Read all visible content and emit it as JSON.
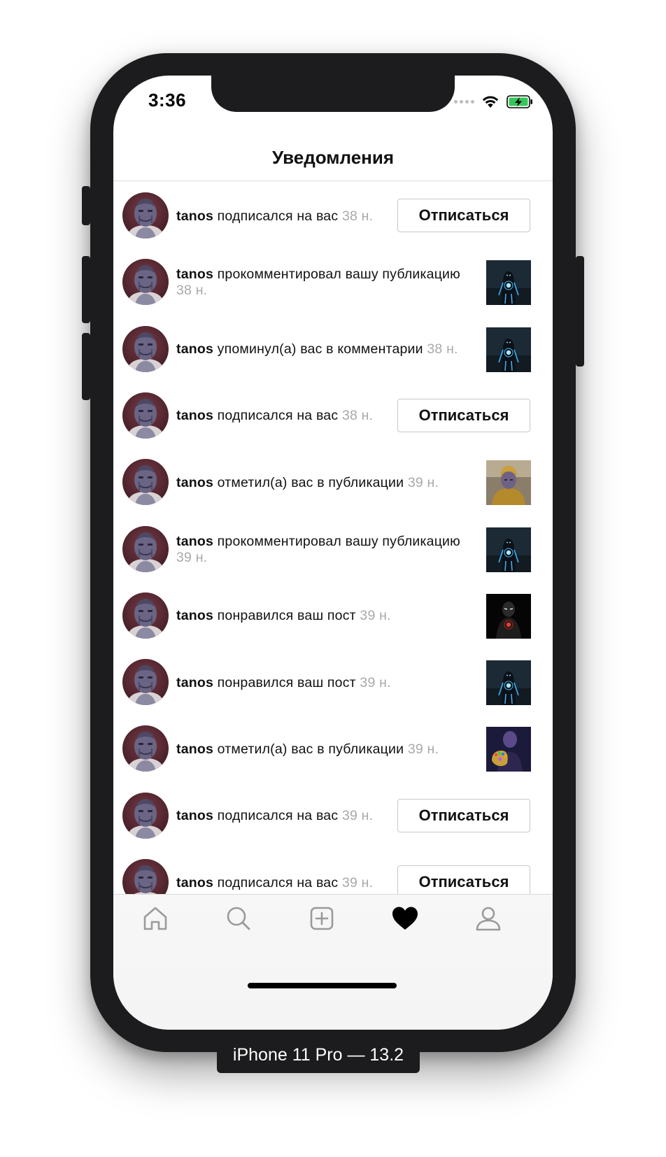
{
  "status_bar": {
    "time": "3:36"
  },
  "header": {
    "title": "Уведомления"
  },
  "notifications": [
    {
      "user": "tanos",
      "action": "подписался на вас",
      "time": "38 н.",
      "type": "follow",
      "button_label": "Отписаться"
    },
    {
      "user": "tanos",
      "action": "прокомментировал вашу публикацию",
      "time": "38 н.",
      "type": "comment",
      "thumb": "ironman-blue"
    },
    {
      "user": "tanos",
      "action": "упоминул(а) вас в комментарии",
      "time": "38 н.",
      "type": "mention",
      "thumb": "ironman-blue"
    },
    {
      "user": "tanos",
      "action": "подписался на вас",
      "time": "38 н.",
      "type": "follow",
      "button_label": "Отписаться"
    },
    {
      "user": "tanos",
      "action": "отметил(а) вас в публикации",
      "time": "39 н.",
      "type": "tag",
      "thumb": "thanos-gold"
    },
    {
      "user": "tanos",
      "action": "прокомментировал вашу публикацию",
      "time": "39 н.",
      "type": "comment",
      "thumb": "ironman-blue"
    },
    {
      "user": "tanos",
      "action": "понравился ваш пост",
      "time": "39 н.",
      "type": "like",
      "thumb": "ironman-red"
    },
    {
      "user": "tanos",
      "action": "понравился ваш пост",
      "time": "39 н.",
      "type": "like",
      "thumb": "ironman-blue"
    },
    {
      "user": "tanos",
      "action": "отметил(а) вас в публикации",
      "time": "39 н.",
      "type": "tag",
      "thumb": "thanos-gauntlet"
    },
    {
      "user": "tanos",
      "action": "подписался на вас",
      "time": "39 н.",
      "type": "follow",
      "button_label": "Отписаться"
    },
    {
      "user": "tanos",
      "action": "подписался на вас",
      "time": "39 н.",
      "type": "follow",
      "button_label": "Отписаться"
    }
  ],
  "tab_bar": {
    "items": [
      {
        "icon": "home-icon",
        "active": false
      },
      {
        "icon": "search-icon",
        "active": false
      },
      {
        "icon": "add-post-icon",
        "active": false
      },
      {
        "icon": "heart-icon",
        "active": true
      },
      {
        "icon": "profile-icon",
        "active": false
      }
    ]
  },
  "device_label": "iPhone 11 Pro — 13.2"
}
